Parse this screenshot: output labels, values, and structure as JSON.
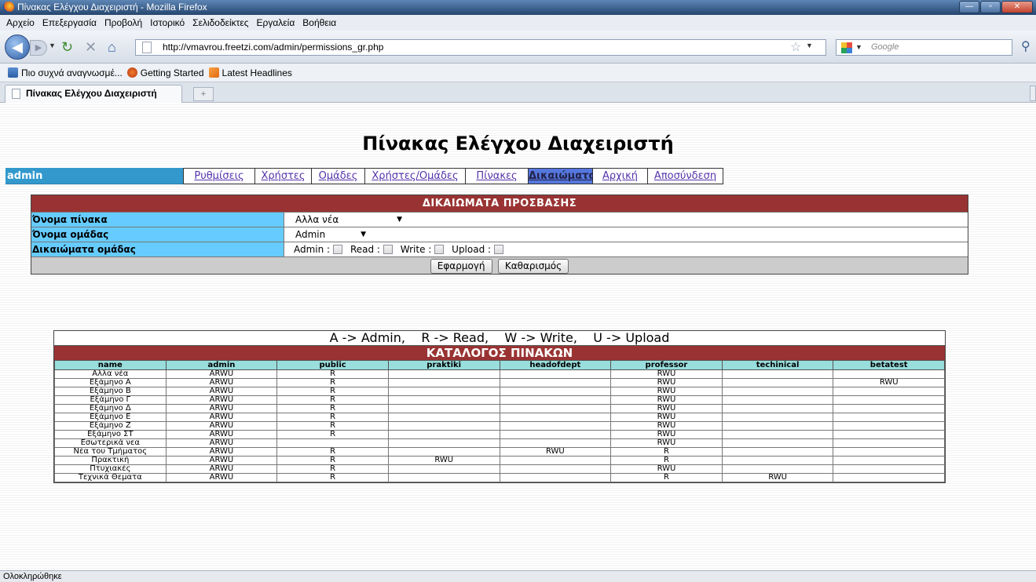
{
  "window": {
    "title": "Πίνακας Ελέγχου Διαχειριστή - Mozilla Firefox",
    "buttons": [
      "—",
      "▫",
      "✕"
    ]
  },
  "menu": [
    "Αρχείο",
    "Επεξεργασία",
    "Προβολή",
    "Ιστορικό",
    "Σελιδοδείκτες",
    "Εργαλεία",
    "Βοήθεια"
  ],
  "nav": {
    "url": "http://vmavrou.freetzi.com/admin/permissions_gr.php",
    "search_placeholder": "Google"
  },
  "bookmarks": [
    "Πιο συχνά αναγνωσμέ...",
    "Getting Started",
    "Latest Headlines"
  ],
  "tab": {
    "title": "Πίνακας Ελέγχου Διαχειριστή",
    "newtab": "+"
  },
  "page": {
    "title": "Πίνακας Ελέγχου Διαχειριστή",
    "user": "admin",
    "menu": [
      {
        "label": "Ρυθμίσεις",
        "active": false
      },
      {
        "label": "Χρήστες",
        "active": false
      },
      {
        "label": "Ομάδες",
        "active": false
      },
      {
        "label": "Χρήστες/Ομάδες",
        "active": false
      },
      {
        "label": "Πίνακες",
        "active": false
      },
      {
        "label": "Δικαιώματα",
        "active": true
      },
      {
        "label": "Αρχική",
        "active": false
      },
      {
        "label": "Αποσύνδεση",
        "active": false
      }
    ]
  },
  "form": {
    "heading": "ΔΙΚΑΙΩΜΑΤΑ ΠΡΟΣΒΑΣΗΣ",
    "table_label": "Όνομα πίνακα",
    "table_value": "Αλλα νέα",
    "group_label": "Όνομα ομάδας",
    "group_value": "Admin",
    "rights_label": "Δικαιώματα ομάδας",
    "rights": [
      "Admin :",
      "Read :",
      "Write :",
      "Upload :"
    ],
    "apply": "Εφαρμογή",
    "clear": "Καθαρισμός"
  },
  "catalog": {
    "legend": "A -> Admin,    R -> Read,    W -> Write,    U -> Upload",
    "heading": "ΚΑΤΑΛΟΓΟΣ ΠΙΝΑΚΩΝ",
    "columns": [
      "name",
      "admin",
      "public",
      "praktiki",
      "headofdept",
      "professor",
      "techinical",
      "betatest"
    ],
    "rows": [
      [
        "Αλλα νέα",
        "ARWU",
        "R",
        "",
        "",
        "RWU",
        "",
        ""
      ],
      [
        "Εξάμηνο Α",
        "ARWU",
        "R",
        "",
        "",
        "RWU",
        "",
        "RWU"
      ],
      [
        "Εξάμηνο Β",
        "ARWU",
        "R",
        "",
        "",
        "RWU",
        "",
        ""
      ],
      [
        "Εξάμηνο Γ",
        "ARWU",
        "R",
        "",
        "",
        "RWU",
        "",
        ""
      ],
      [
        "Εξάμηνο Δ",
        "ARWU",
        "R",
        "",
        "",
        "RWU",
        "",
        ""
      ],
      [
        "Εξάμηνο Ε",
        "ARWU",
        "R",
        "",
        "",
        "RWU",
        "",
        ""
      ],
      [
        "Εξάμηνο Ζ",
        "ARWU",
        "R",
        "",
        "",
        "RWU",
        "",
        ""
      ],
      [
        "Εξάμηνο ΣΤ",
        "ARWU",
        "R",
        "",
        "",
        "RWU",
        "",
        ""
      ],
      [
        "Εσωτερικά νεα",
        "ARWU",
        "",
        "",
        "",
        "RWU",
        "",
        ""
      ],
      [
        "Νέα του Τμήματος",
        "ARWU",
        "R",
        "",
        "RWU",
        "R",
        "",
        ""
      ],
      [
        "Πρακτική",
        "ARWU",
        "R",
        "RWU",
        "",
        "R",
        "",
        ""
      ],
      [
        "Πτυχιακές",
        "ARWU",
        "R",
        "",
        "",
        "RWU",
        "",
        ""
      ],
      [
        "Τεχνικά Θεματα",
        "ARWU",
        "R",
        "",
        "",
        "R",
        "RWU",
        ""
      ]
    ]
  },
  "status": "Ολοκληρώθηκε"
}
